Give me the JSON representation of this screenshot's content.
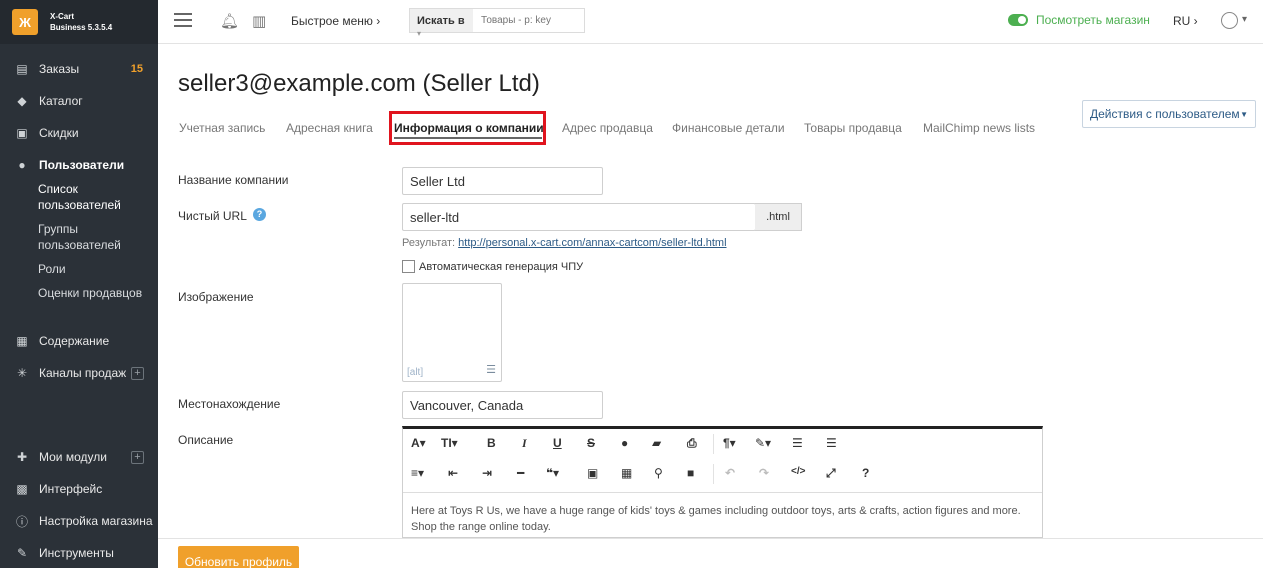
{
  "brand": {
    "logo": "Ж",
    "name": "X-Cart",
    "version": "Business 5.3.5.4"
  },
  "sidebar": {
    "items": [
      {
        "label": "Заказы",
        "icon": "orders-icon",
        "badge": "15"
      },
      {
        "label": "Каталог",
        "icon": "tag-icon"
      },
      {
        "label": "Скидки",
        "icon": "gift-icon"
      },
      {
        "label": "Пользователи",
        "icon": "users-icon"
      },
      {
        "label": "Содержание",
        "icon": "content-icon"
      },
      {
        "label": "Каналы продаж",
        "icon": "channels-icon"
      },
      {
        "label": "Мои модули",
        "icon": "modules-icon"
      },
      {
        "label": "Интерфейс",
        "icon": "interface-icon"
      },
      {
        "label": "Настройка магазина",
        "icon": "info-icon"
      },
      {
        "label": "Инструменты",
        "icon": "tools-icon"
      }
    ],
    "sub_items": [
      "Список пользователей",
      "Группы пользователей",
      "Роли",
      "Оценки продавцов"
    ]
  },
  "topbar": {
    "quick_menu": "Быстрое меню",
    "search_in": "Искать в",
    "search_placeholder": "Товары - p: key",
    "view_store": "Посмотреть магазин",
    "lang": "RU"
  },
  "page": {
    "title": "seller3@example.com (Seller Ltd)",
    "actions_button": "Действия с пользователем",
    "tabs": [
      "Учетная запись",
      "Адресная книга",
      "Информация о компании",
      "Адрес продавца",
      "Финансовые детали",
      "Товары продавца",
      "MailChimp news lists"
    ]
  },
  "form": {
    "company_name_label": "Название компании",
    "company_name_value": "Seller Ltd",
    "clean_url_label": "Чистый URL",
    "clean_url_value": "seller-ltd",
    "clean_url_suffix": ".html",
    "result_label": "Результат:",
    "result_url": "http://personal.x-cart.com/annax-cartcom/seller-ltd.html",
    "auto_gen_label": "Автоматическая генерация ЧПУ",
    "image_label": "Изображение",
    "image_alt": "[alt]",
    "location_label": "Местонахождение",
    "location_value": "Vancouver, Canada",
    "description_label": "Описание",
    "description_text": "Here at Toys R Us, we have a huge range of kids' toys & games including outdoor toys, arts & crafts, action figures and more. Shop the range online today."
  },
  "footer": {
    "update_button": "Обновить профиль"
  }
}
